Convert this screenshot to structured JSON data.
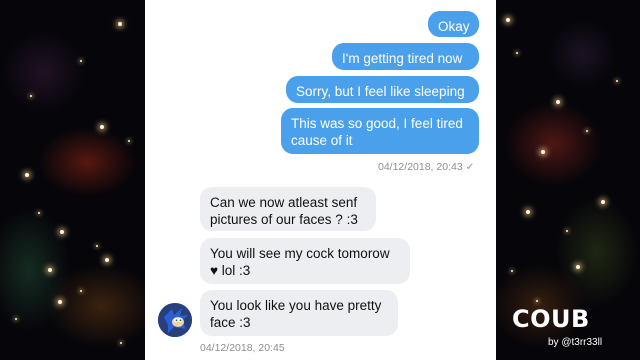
{
  "sent_messages": [
    {
      "text": "Okay"
    },
    {
      "text": "I'm getting tired now"
    },
    {
      "text": "Sorry, but I feel like sleeping"
    },
    {
      "text": "This was so good, I feel tired cause of it"
    }
  ],
  "sent_timestamp": "04/12/2018, 20:43",
  "read_check": "✓",
  "received_messages": [
    {
      "text": "Can we now atleast senf pictures of our faces ? :3"
    },
    {
      "text": "You will see my cock tomorow ♥ lol :3"
    },
    {
      "text": "You look like you have pretty face :3"
    }
  ],
  "received_timestamp": "04/12/2018, 20:45",
  "watermark": {
    "brand": "COUB",
    "author": "by @t3rr33ll"
  },
  "colors": {
    "outgoing": "#4aa0ea",
    "incoming": "#eceef1",
    "avatar": "#3a5fb5"
  }
}
